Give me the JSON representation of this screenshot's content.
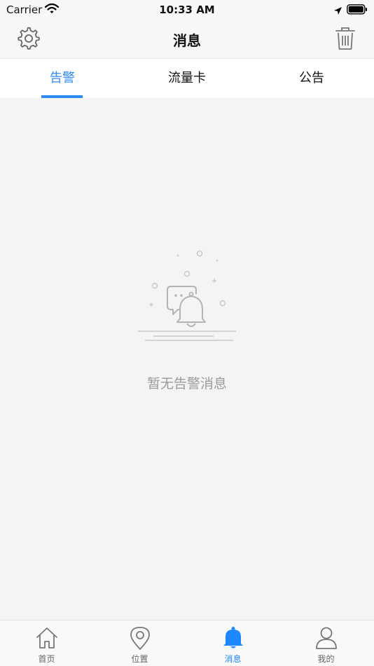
{
  "status_bar": {
    "carrier": "Carrier",
    "time": "10:33 AM"
  },
  "header": {
    "title": "消息"
  },
  "tabs": [
    {
      "label": "告警",
      "selected": true
    },
    {
      "label": "流量卡",
      "selected": false
    },
    {
      "label": "公告",
      "selected": false
    }
  ],
  "empty_state": {
    "message": "暂无告警消息",
    "icon": "bell-chat-icon"
  },
  "bottom_nav": [
    {
      "label": "首页",
      "icon": "home-icon",
      "active": false
    },
    {
      "label": "位置",
      "icon": "location-icon",
      "active": false
    },
    {
      "label": "消息",
      "icon": "bell-icon",
      "active": true
    },
    {
      "label": "我的",
      "icon": "user-icon",
      "active": false
    }
  ],
  "colors": {
    "accent": "#2d8cf0",
    "tab_active": "#1e88ff",
    "background": "#f4f4f4"
  }
}
